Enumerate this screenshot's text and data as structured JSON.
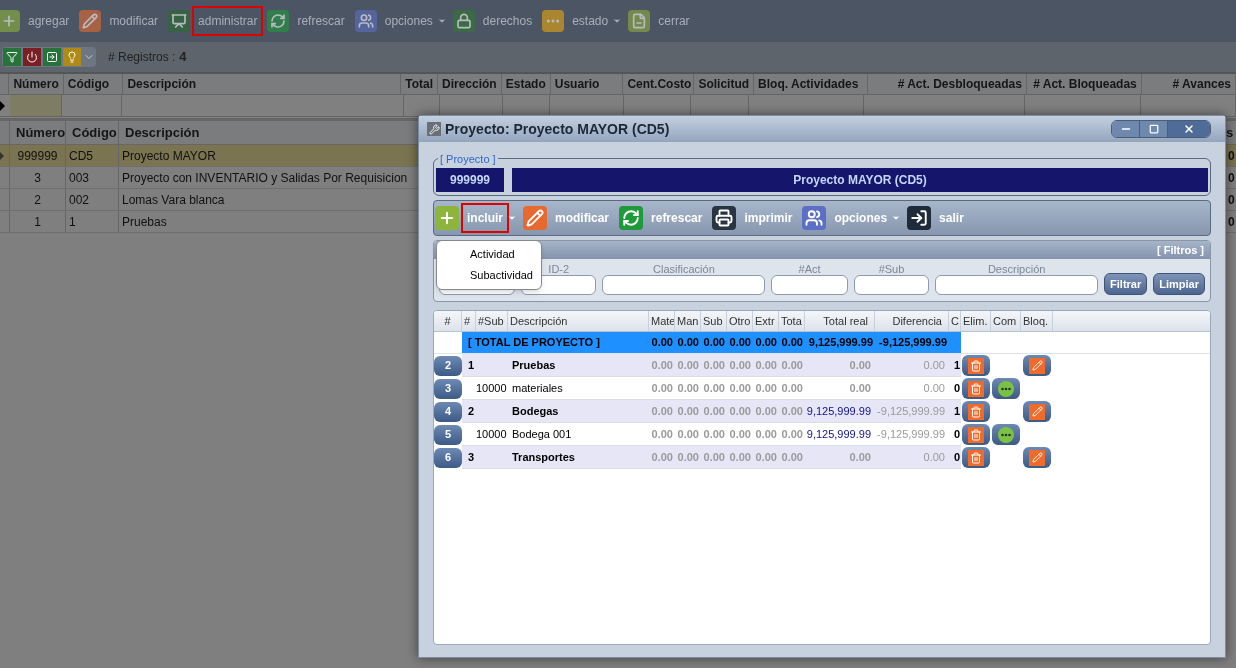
{
  "toolbar": [
    {
      "kind": "add",
      "label": "agregar",
      "dropdown": false,
      "highlighted": false
    },
    {
      "kind": "edit",
      "label": "modificar",
      "dropdown": false,
      "highlighted": false
    },
    {
      "kind": "admin",
      "label": "administrar",
      "dropdown": false,
      "highlighted": true
    },
    {
      "kind": "refresh",
      "label": "refrescar",
      "dropdown": false,
      "highlighted": false
    },
    {
      "kind": "options",
      "label": "opciones",
      "dropdown": true,
      "highlighted": false
    },
    {
      "kind": "rights",
      "label": "derechos",
      "dropdown": false,
      "highlighted": false
    },
    {
      "kind": "status",
      "label": "estado",
      "dropdown": true,
      "highlighted": false
    },
    {
      "kind": "close",
      "label": "cerrar",
      "dropdown": false,
      "highlighted": false
    }
  ],
  "records": {
    "label": "# Registros :",
    "count": "4"
  },
  "filter_grid": {
    "columns": [
      "Número",
      "Código",
      "Descripción",
      "Total",
      "Dirección",
      "Estado",
      "Usuario",
      "Cent.Costo",
      "Solicitud",
      "Bloq. Actividades",
      "# Act. Desbloqueadas",
      "# Act. Bloqueadas",
      "# Avances"
    ]
  },
  "grid": {
    "columns": [
      "Número",
      "Código",
      "Descripción"
    ],
    "column_4": "s",
    "rows": [
      {
        "numero": "999999",
        "codigo": "CD5",
        "descripcion": "Proyecto MAYOR",
        "column_4": "0",
        "selected": true
      },
      {
        "numero": "3",
        "codigo": "003",
        "descripcion": "Proyecto con INVENTARIO y Salidas Por Requisicion",
        "column_4": "0",
        "selected": false
      },
      {
        "numero": "2",
        "codigo": "002",
        "descripcion": "Lomas Vara blanca",
        "column_4": "0",
        "selected": false
      },
      {
        "numero": "1",
        "codigo": "1",
        "descripcion": "Pruebas",
        "column_4": "0",
        "selected": false
      }
    ]
  },
  "dialog": {
    "title": "Proyecto: Proyecto MAYOR (CD5)",
    "project": {
      "legend": "[ Proyecto ]",
      "number": "999999",
      "name": "Proyecto MAYOR (CD5)"
    },
    "toolbar": [
      {
        "kind": "add",
        "label": "incluir",
        "dropdown": true,
        "highlighted": true
      },
      {
        "kind": "edit",
        "label": "modificar",
        "dropdown": false,
        "highlighted": false
      },
      {
        "kind": "refresh",
        "label": "refrescar",
        "dropdown": false,
        "highlighted": false
      },
      {
        "kind": "print",
        "label": "imprimir",
        "dropdown": false,
        "highlighted": false
      },
      {
        "kind": "options",
        "label": "opciones",
        "dropdown": true,
        "highlighted": false
      },
      {
        "kind": "exit",
        "label": "salir",
        "dropdown": false,
        "highlighted": false
      }
    ],
    "menu": [
      "Actividad",
      "Subactividad"
    ],
    "filters": {
      "title": "[ Filtros ]",
      "fields": [
        {
          "label": "ID-2"
        },
        {
          "label": "Clasificación"
        },
        {
          "label": "#Act"
        },
        {
          "label": "#Sub"
        },
        {
          "label": "Descripción"
        }
      ],
      "buttons": [
        "Filtrar",
        "Limpiar"
      ]
    },
    "table": {
      "columns": [
        "#",
        "#",
        "#Sub",
        "Descripción",
        "Mate",
        "Man",
        "Sub",
        "Otro",
        "Extr",
        "Tota",
        "Total real",
        "Diferencia",
        "C",
        "Elim.",
        "Com",
        "Bloq."
      ],
      "total_row": {
        "label": "[ TOTAL DE PROYECTO ]",
        "values": [
          "0.00",
          "0.00",
          "0.00",
          "0.00",
          "0.00",
          "0.00",
          "9,125,999.99",
          "-9,125,999.99"
        ]
      },
      "rows": [
        {
          "kind": "activity",
          "index": "2",
          "number": "1",
          "description": "Pruebas",
          "values": [
            "0.00",
            "0.00",
            "0.00",
            "0.00",
            "0.00",
            "0.00"
          ],
          "total_real": "0.00",
          "total_real_highlight": false,
          "diferencia": "0.00",
          "c": "1"
        },
        {
          "kind": "subactivity",
          "index": "3",
          "sub": "10000",
          "description": "materiales",
          "values": [
            "0.00",
            "0.00",
            "0.00",
            "0.00",
            "0.00",
            "0.00"
          ],
          "total_real": "0.00",
          "total_real_highlight": false,
          "diferencia": "0.00",
          "c": "0"
        },
        {
          "kind": "activity",
          "index": "4",
          "number": "2",
          "description": "Bodegas",
          "values": [
            "0.00",
            "0.00",
            "0.00",
            "0.00",
            "0.00",
            "0.00"
          ],
          "total_real": "9,125,999.99",
          "total_real_highlight": true,
          "diferencia": "-9,125,999.99",
          "c": "1"
        },
        {
          "kind": "subactivity",
          "index": "5",
          "sub": "10000",
          "description": "Bodega 001",
          "values": [
            "0.00",
            "0.00",
            "0.00",
            "0.00",
            "0.00",
            "0.00"
          ],
          "total_real": "9,125,999.99",
          "total_real_highlight": true,
          "diferencia": "-9,125,999.99",
          "c": "0"
        },
        {
          "kind": "activity",
          "index": "6",
          "number": "3",
          "description": "Transportes",
          "values": [
            "0.00",
            "0.00",
            "0.00",
            "0.00",
            "0.00",
            "0.00"
          ],
          "total_real": "0.00",
          "total_real_highlight": false,
          "diferencia": "0.00",
          "c": "0"
        }
      ]
    }
  }
}
